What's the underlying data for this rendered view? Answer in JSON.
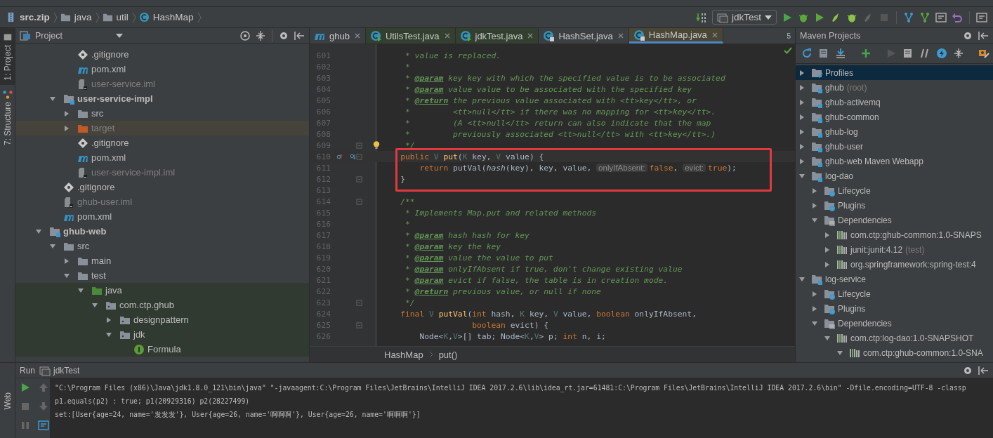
{
  "breadcrumbs": [
    {
      "label": "src.zip",
      "kind": "archive"
    },
    {
      "label": "java",
      "kind": "folder"
    },
    {
      "label": "util",
      "kind": "folder"
    },
    {
      "label": "HashMap",
      "kind": "class"
    }
  ],
  "run_config": "jdkTest",
  "side_tabs": [
    {
      "label": "1: Project",
      "selected": true
    },
    {
      "label": "7: Structure",
      "selected": false
    }
  ],
  "project_panel": {
    "title": "Project",
    "tree": [
      {
        "children": [
          {
            "children": [
              {
                "label": ".gitignore",
                "kind": "git"
              },
              {
                "label": "pom.xml",
                "kind": "maven"
              },
              {
                "label": "user-service.iml",
                "kind": "iml"
              }
            ]
          },
          {
            "label": "user-service-impl",
            "kind": "module",
            "expanded": true,
            "children": [
              {
                "label": "src",
                "kind": "folder",
                "expanded": false
              },
              {
                "label": "target",
                "kind": "excluded",
                "expanded": false
              },
              {
                "label": ".gitignore",
                "kind": "git"
              },
              {
                "label": "pom.xml",
                "kind": "maven"
              },
              {
                "label": "user-service-impl.iml",
                "kind": "iml"
              }
            ]
          },
          {
            "label": ".gitignore",
            "kind": "git"
          },
          {
            "label": "ghub-user.iml",
            "kind": "iml"
          },
          {
            "label": "pom.xml",
            "kind": "maven"
          }
        ]
      },
      {
        "label": "ghub-web",
        "kind": "module",
        "expanded": true,
        "children": [
          {
            "label": "src",
            "kind": "folder",
            "expanded": true,
            "children": [
              {
                "label": "main",
                "kind": "folder",
                "expanded": false
              },
              {
                "label": "test",
                "kind": "folder",
                "expanded": true,
                "children": [
                  {
                    "label": "java",
                    "kind": "test-root",
                    "expanded": true,
                    "test_scope": true,
                    "children": [
                      {
                        "label": "com.ctp.ghub",
                        "kind": "package",
                        "expanded": true,
                        "test_scope": true,
                        "children": [
                          {
                            "label": "designpattern",
                            "kind": "package",
                            "expanded": false,
                            "test_scope": true
                          },
                          {
                            "label": "jdk",
                            "kind": "package",
                            "expanded": true,
                            "test_scope": true,
                            "children": [
                              {
                                "label": "Formula",
                                "kind": "interface",
                                "test_scope": true
                              }
                            ]
                          }
                        ]
                      }
                    ]
                  }
                ]
              }
            ]
          }
        ]
      }
    ]
  },
  "editor": {
    "tabs": [
      {
        "label": "ghub",
        "kind": "maven",
        "selected": false,
        "color": "#3c3f41"
      },
      {
        "label": "UtilsTest.java",
        "kind": "class",
        "selected": false,
        "color": "#34402f"
      },
      {
        "label": "jdkTest.java",
        "kind": "class",
        "selected": false,
        "color": "#34402f"
      },
      {
        "label": "HashSet.java",
        "kind": "locked-class",
        "selected": false,
        "color": "#3c3f41"
      },
      {
        "label": "HashMap.java",
        "kind": "locked-class",
        "selected": true,
        "color": "#4a4636"
      }
    ],
    "hidden_tabs": "5",
    "lines": [
      {
        "number": "601",
        "segments": [
          {
            "kind": "comment",
            "text": "     * value is replaced."
          }
        ]
      },
      {
        "number": "602",
        "segments": [
          {
            "kind": "comment",
            "text": "     *"
          }
        ]
      },
      {
        "number": "603",
        "segments": [
          {
            "kind": "comment",
            "text": "     * "
          },
          {
            "kind": "tag",
            "text": "@param"
          },
          {
            "kind": "comment",
            "text": " key key with which the specified value is to be associated"
          }
        ]
      },
      {
        "number": "604",
        "segments": [
          {
            "kind": "comment",
            "text": "     * "
          },
          {
            "kind": "tag",
            "text": "@param"
          },
          {
            "kind": "comment",
            "text": " value value to be associated with the specified key"
          }
        ]
      },
      {
        "number": "605",
        "segments": [
          {
            "kind": "comment",
            "text": "     * "
          },
          {
            "kind": "tag",
            "text": "@return"
          },
          {
            "kind": "comment",
            "text": " the previous value associated with <tt>key</tt>, or"
          }
        ]
      },
      {
        "number": "606",
        "segments": [
          {
            "kind": "comment",
            "text": "     *         <tt>null</tt> if there was no mapping for <tt>key</tt>."
          }
        ]
      },
      {
        "number": "607",
        "segments": [
          {
            "kind": "comment",
            "text": "     *         (A <tt>null</tt> return can also indicate that the map"
          }
        ]
      },
      {
        "number": "608",
        "segments": [
          {
            "kind": "comment",
            "text": "     *         previously associated <tt>null</tt> with <tt>key</tt>.)"
          }
        ]
      },
      {
        "number": "609",
        "fold": true,
        "bulb": true,
        "segments": [
          {
            "kind": "comment",
            "text": "     */"
          }
        ]
      },
      {
        "number": "610",
        "fold": true,
        "boxed": true,
        "markers": true,
        "segments": [
          {
            "kind": "keyword",
            "text": "    public "
          },
          {
            "kind": "type",
            "text": "V"
          },
          {
            "kind": "decl",
            "text": " put"
          },
          {
            "kind": "plain",
            "text": "("
          },
          {
            "kind": "type",
            "text": "K"
          },
          {
            "kind": "plain",
            "text": " key, "
          },
          {
            "kind": "type",
            "text": "V"
          },
          {
            "kind": "plain",
            "text": " value) {"
          }
        ]
      },
      {
        "number": "611",
        "boxed": true,
        "segments": [
          {
            "kind": "keyword",
            "text": "        return"
          },
          {
            "kind": "plain",
            "text": " putVal("
          },
          {
            "kind": "static",
            "text": "hash"
          },
          {
            "kind": "plain",
            "text": "(key), key, value, "
          },
          {
            "kind": "hint",
            "text": "onlyIfAbsent:"
          },
          {
            "kind": "keyword",
            "text": "false"
          },
          {
            "kind": "plain",
            "text": ", "
          },
          {
            "kind": "hint",
            "text": "evict:"
          },
          {
            "kind": "keyword",
            "text": "true"
          },
          {
            "kind": "plain",
            "text": ");"
          }
        ]
      },
      {
        "number": "612",
        "fold": true,
        "boxed": true,
        "segments": [
          {
            "kind": "plain",
            "text": "    }"
          }
        ]
      },
      {
        "number": "613"
      },
      {
        "number": "614",
        "fold": true,
        "segments": [
          {
            "kind": "comment",
            "text": "    /**"
          }
        ]
      },
      {
        "number": "615",
        "segments": [
          {
            "kind": "comment",
            "text": "     * Implements Map.put and related methods"
          }
        ]
      },
      {
        "number": "616",
        "segments": [
          {
            "kind": "comment",
            "text": "     *"
          }
        ]
      },
      {
        "number": "617",
        "segments": [
          {
            "kind": "comment",
            "text": "     * "
          },
          {
            "kind": "tag",
            "text": "@param"
          },
          {
            "kind": "comment",
            "text": " hash hash for key"
          }
        ]
      },
      {
        "number": "618",
        "segments": [
          {
            "kind": "comment",
            "text": "     * "
          },
          {
            "kind": "tag",
            "text": "@param"
          },
          {
            "kind": "comment",
            "text": " key the key"
          }
        ]
      },
      {
        "number": "619",
        "segments": [
          {
            "kind": "comment",
            "text": "     * "
          },
          {
            "kind": "tag",
            "text": "@param"
          },
          {
            "kind": "comment",
            "text": " value the value to put"
          }
        ]
      },
      {
        "number": "620",
        "segments": [
          {
            "kind": "comment",
            "text": "     * "
          },
          {
            "kind": "tag",
            "text": "@param"
          },
          {
            "kind": "comment",
            "text": " onlyIfAbsent if true, don't change existing value"
          }
        ]
      },
      {
        "number": "621",
        "segments": [
          {
            "kind": "comment",
            "text": "     * "
          },
          {
            "kind": "tag",
            "text": "@param"
          },
          {
            "kind": "comment",
            "text": " evict if false, the table is in creation mode."
          }
        ]
      },
      {
        "number": "622",
        "segments": [
          {
            "kind": "comment",
            "text": "     * "
          },
          {
            "kind": "tag",
            "text": "@return"
          },
          {
            "kind": "comment",
            "text": " previous value, or null if none"
          }
        ]
      },
      {
        "number": "623",
        "fold": true,
        "segments": [
          {
            "kind": "comment",
            "text": "     */"
          }
        ]
      },
      {
        "number": "624",
        "segments": [
          {
            "kind": "keyword",
            "text": "    final "
          },
          {
            "kind": "type",
            "text": "V"
          },
          {
            "kind": "decl",
            "text": " putVal"
          },
          {
            "kind": "plain",
            "text": "("
          },
          {
            "kind": "keyword",
            "text": "int"
          },
          {
            "kind": "plain",
            "text": " hash, "
          },
          {
            "kind": "type",
            "text": "K"
          },
          {
            "kind": "plain",
            "text": " key, "
          },
          {
            "kind": "type",
            "text": "V"
          },
          {
            "kind": "plain",
            "text": " value, "
          },
          {
            "kind": "keyword",
            "text": "boolean"
          },
          {
            "kind": "plain",
            "text": " onlyIfAbsent,"
          }
        ]
      },
      {
        "number": "625",
        "fold": true,
        "segments": [
          {
            "kind": "keyword",
            "text": "                   boolean"
          },
          {
            "kind": "plain",
            "text": " evict) {"
          }
        ]
      },
      {
        "number": "626",
        "segments": [
          {
            "kind": "plain",
            "text": "        Node<"
          },
          {
            "kind": "type",
            "text": "K"
          },
          {
            "kind": "plain",
            "text": ","
          },
          {
            "kind": "type",
            "text": "V"
          },
          {
            "kind": "plain",
            "text": ">[] tab; Node<"
          },
          {
            "kind": "type",
            "text": "K"
          },
          {
            "kind": "plain",
            "text": ","
          },
          {
            "kind": "type",
            "text": "V"
          },
          {
            "kind": "plain",
            "text": "> p; "
          },
          {
            "kind": "keyword",
            "text": "int"
          },
          {
            "kind": "plain",
            "text": " n, i;"
          }
        ]
      }
    ],
    "footer": [
      "HashMap",
      "put()"
    ]
  },
  "maven_panel": {
    "title": "Maven Projects",
    "tree": [
      {
        "label": "Profiles",
        "kind": "profiles",
        "expanded": false,
        "selected": true
      },
      {
        "label": "ghub",
        "note": "(root)",
        "kind": "module",
        "expanded": false,
        "selected": false
      },
      {
        "label": "ghub-activemq",
        "kind": "module",
        "expanded": false,
        "selected": false
      },
      {
        "label": "ghub-common",
        "kind": "module",
        "expanded": false,
        "selected": false
      },
      {
        "label": "ghub-log",
        "kind": "module",
        "expanded": false,
        "selected": false
      },
      {
        "label": "ghub-user",
        "kind": "module",
        "expanded": false,
        "selected": false
      },
      {
        "label": "ghub-web Maven Webapp",
        "kind": "module",
        "expanded": false,
        "selected": false
      },
      {
        "label": "log-dao",
        "kind": "module",
        "expanded": true,
        "selected": false,
        "children": [
          {
            "label": "Lifecycle",
            "kind": "lifecycle",
            "expanded": false,
            "selected": false
          },
          {
            "label": "Plugins",
            "kind": "lifecycle",
            "expanded": false,
            "selected": false
          },
          {
            "label": "Dependencies",
            "kind": "dependencies",
            "expanded": true,
            "selected": false,
            "children": [
              {
                "label": "com.ctp:ghub-common:1.0-SNAPS",
                "kind": "library",
                "expanded": false,
                "selected": false
              },
              {
                "label": "junit:junit:4.12",
                "note": "(test)",
                "kind": "library",
                "expanded": false,
                "selected": false
              },
              {
                "label": "org.springframework:spring-test:4",
                "kind": "library",
                "expanded": false,
                "selected": false
              }
            ]
          }
        ]
      },
      {
        "label": "log-service",
        "kind": "module",
        "expanded": true,
        "selected": false,
        "children": [
          {
            "label": "Lifecycle",
            "kind": "lifecycle",
            "expanded": false,
            "selected": false
          },
          {
            "label": "Plugins",
            "kind": "lifecycle",
            "expanded": false,
            "selected": false
          },
          {
            "label": "Dependencies",
            "kind": "dependencies",
            "expanded": true,
            "selected": false,
            "children": [
              {
                "label": "com.ctp:log-dao:1.0-SNAPSHOT",
                "kind": "library",
                "expanded": true,
                "selected": false,
                "children": [
                  {
                    "label": "com.ctp:ghub-common:1.0-SNA",
                    "kind": "library",
                    "expanded": true,
                    "selected": false
                  }
                ]
              }
            ]
          }
        ]
      }
    ]
  },
  "run_panel": {
    "title": "Run",
    "tab": "jdkTest",
    "side_label": "Web",
    "console": [
      "\"C:\\Program Files (x86)\\Java\\jdk1.8.0_121\\bin\\java\" \"-javaagent:C:\\Program Files\\JetBrains\\IntelliJ IDEA 2017.2.6\\lib\\idea_rt.jar=61481:C:\\Program Files\\JetBrains\\IntelliJ IDEA 2017.2.6\\bin\" -Dfile.encoding=UTF-8 -classp",
      "p1.equals(p2) : true; p1(20929316) p2(28227499)",
      "set:[User{age=24, name='发发发'}, User{age=26, name='啊啊啊'}, User{age=26, name='啊啊啊'}]"
    ]
  }
}
